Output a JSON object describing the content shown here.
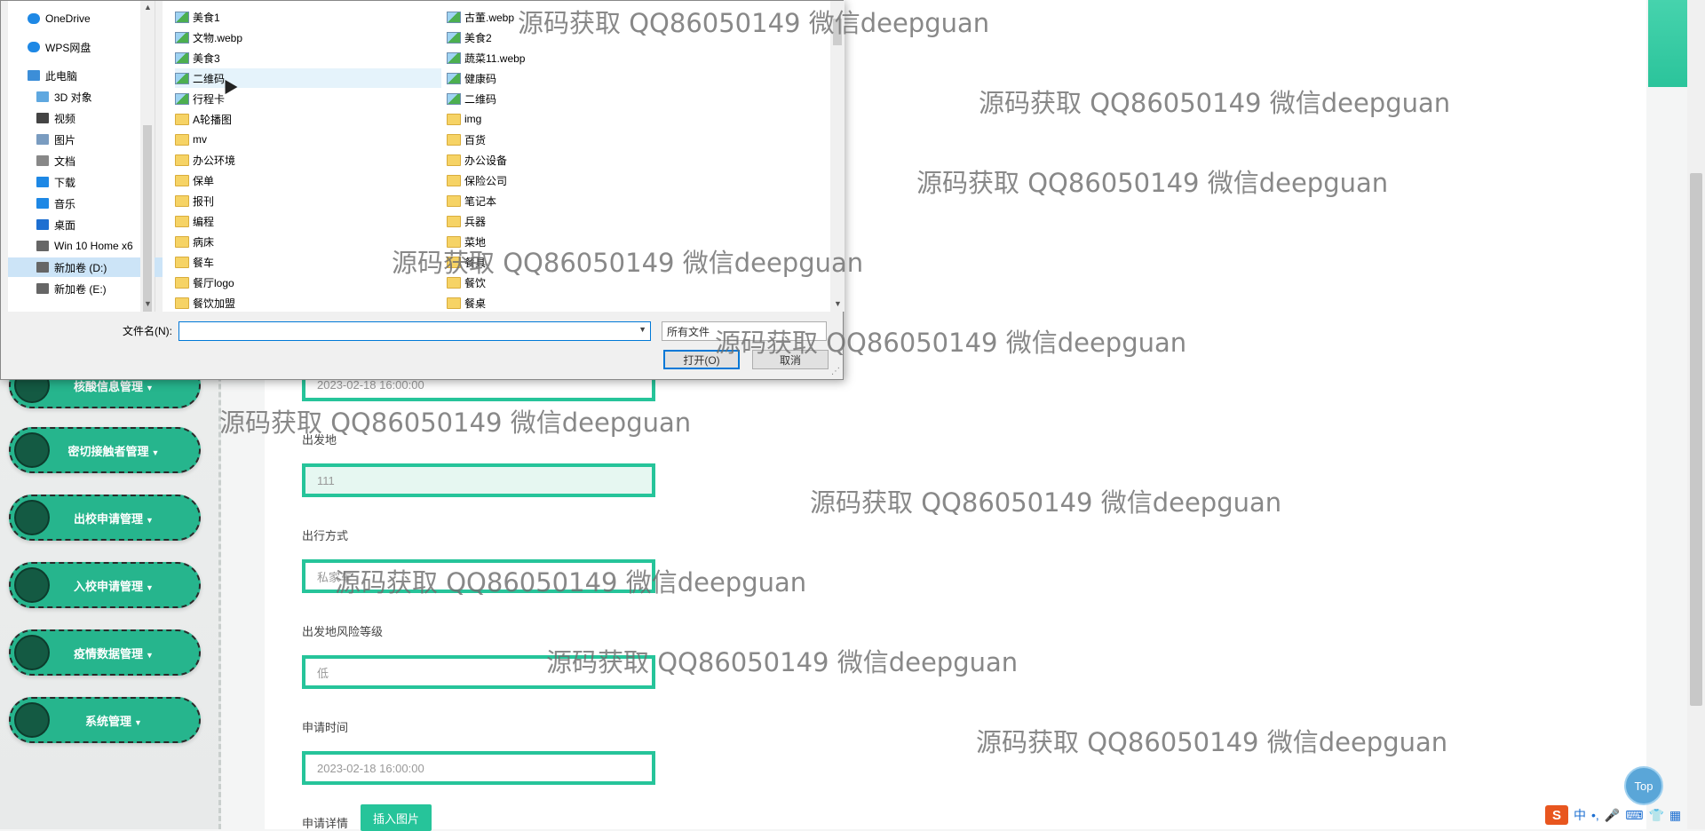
{
  "sidebar": {
    "items": [
      {
        "label": "核酸信息管理"
      },
      {
        "label": "密切接触者管理"
      },
      {
        "label": "出校申请管理"
      },
      {
        "label": "入校申请管理"
      },
      {
        "label": "疫情数据管理"
      },
      {
        "label": "系统管理"
      }
    ]
  },
  "form": {
    "time_top_value": "2023-02-18 16:00:00",
    "departure_label": "出发地",
    "departure_value": "111",
    "travel_mode_label": "出行方式",
    "travel_mode_value": "私家车",
    "risk_label": "出发地风险等级",
    "risk_value": "低",
    "apply_time_label": "申请时间",
    "apply_time_value": "2023-02-18 16:00:00",
    "detail_label": "申请详情",
    "insert_image_button": "插入图片"
  },
  "top_button": "Top",
  "ime": {
    "logo": "S",
    "lang": "中",
    "punct": "•,"
  },
  "dialog": {
    "nav_items": [
      {
        "label": "OneDrive",
        "icon": "cloud-icon"
      },
      {
        "label": "WPS网盘",
        "icon": "cloud-icon"
      },
      {
        "label": "此电脑",
        "icon": "computer-icon"
      },
      {
        "label": "3D 对象",
        "icon": "cube-icon"
      },
      {
        "label": "视频",
        "icon": "video-icon"
      },
      {
        "label": "图片",
        "icon": "picture-icon"
      },
      {
        "label": "文档",
        "icon": "document-icon"
      },
      {
        "label": "下载",
        "icon": "download-icon"
      },
      {
        "label": "音乐",
        "icon": "music-icon"
      },
      {
        "label": "桌面",
        "icon": "desktop-icon"
      },
      {
        "label": "Win 10 Home x6",
        "icon": "drive-icon"
      },
      {
        "label": "新加卷 (D:)",
        "icon": "drive-icon"
      },
      {
        "label": "新加卷 (E:)",
        "icon": "drive-icon"
      }
    ],
    "files_col1": [
      {
        "name": "美食1",
        "type": "image"
      },
      {
        "name": "文物.webp",
        "type": "image"
      },
      {
        "name": "美食3",
        "type": "image"
      },
      {
        "name": "二维码",
        "type": "image"
      },
      {
        "name": "行程卡",
        "type": "image"
      },
      {
        "name": "A轮播图",
        "type": "folder"
      },
      {
        "name": "mv",
        "type": "folder"
      },
      {
        "name": "办公环境",
        "type": "folder"
      },
      {
        "name": "保单",
        "type": "folder"
      },
      {
        "name": "报刊",
        "type": "folder"
      },
      {
        "name": "编程",
        "type": "folder"
      },
      {
        "name": "病床",
        "type": "folder"
      },
      {
        "name": "餐车",
        "type": "folder"
      },
      {
        "name": "餐厅logo",
        "type": "folder"
      },
      {
        "name": "餐饮加盟",
        "type": "folder"
      }
    ],
    "files_col2": [
      {
        "name": "古董.webp",
        "type": "image"
      },
      {
        "name": "美食2",
        "type": "image"
      },
      {
        "name": "蔬菜11.webp",
        "type": "image"
      },
      {
        "name": "健康码",
        "type": "image"
      },
      {
        "name": "二维码",
        "type": "image"
      },
      {
        "name": "img",
        "type": "folder"
      },
      {
        "name": "百货",
        "type": "folder"
      },
      {
        "name": "办公设备",
        "type": "folder"
      },
      {
        "name": "保险公司",
        "type": "folder"
      },
      {
        "name": "笔记本",
        "type": "folder"
      },
      {
        "name": "兵器",
        "type": "folder"
      },
      {
        "name": "菜地",
        "type": "folder"
      },
      {
        "name": "餐具",
        "type": "folder"
      },
      {
        "name": "餐饮",
        "type": "folder"
      },
      {
        "name": "餐桌",
        "type": "folder"
      }
    ],
    "filename_label": "文件名(N):",
    "filename_value": "",
    "filetype_value": "所有文件",
    "open_button": "打开(O)",
    "cancel_button": "取消"
  },
  "watermark": "源码获取 QQ86050149 微信deepguan"
}
